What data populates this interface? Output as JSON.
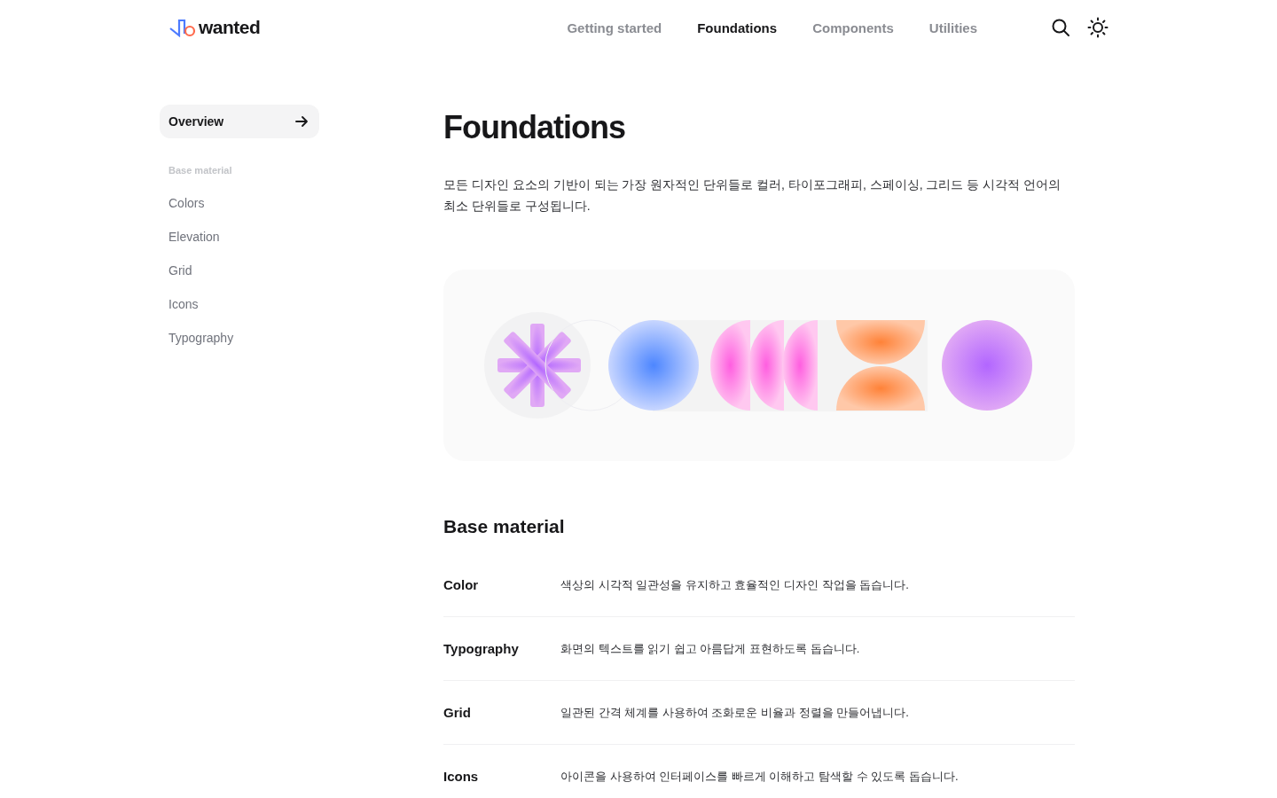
{
  "header": {
    "logo": "wanted",
    "nav": [
      {
        "label": "Getting started",
        "selected": false
      },
      {
        "label": "Foundations",
        "selected": true
      },
      {
        "label": "Components",
        "selected": false
      },
      {
        "label": "Utilities",
        "selected": false
      }
    ]
  },
  "sidebar": {
    "overview": {
      "label": "Overview",
      "selected": true
    },
    "section": "Base material",
    "items": [
      {
        "label": "Colors",
        "selected": false
      },
      {
        "label": "Elevation",
        "selected": false
      },
      {
        "label": "Grid",
        "selected": false
      },
      {
        "label": "Icons",
        "selected": false
      },
      {
        "label": "Typography",
        "selected": false
      }
    ]
  },
  "page": {
    "title": "Foundations",
    "description": "모든 디자인 요소의 기반이 되는 가장 원자적인 단위들로 컬러, 타이포그래피, 스페이싱, 그리드 등 시각적 언어의 최소 단위들로 구성됩니다.",
    "section_title": "Base material",
    "rows": [
      {
        "name": "Color",
        "description": "색상의 시각적 일관성을 유지하고 효율적인 디자인 작업을 돕습니다."
      },
      {
        "name": "Typography",
        "description": "화면의 텍스트를 읽기 쉽고 아름답게 표현하도록 돕습니다."
      },
      {
        "name": "Grid",
        "description": "일관된 간격 체계를 사용하여 조화로운 비율과 정렬을 만들어냅니다."
      },
      {
        "name": "Icons",
        "description": "아이콘을 사용하여 인터페이스를 빠르게 이해하고 탐색할 수 있도록 돕습니다."
      }
    ]
  }
}
